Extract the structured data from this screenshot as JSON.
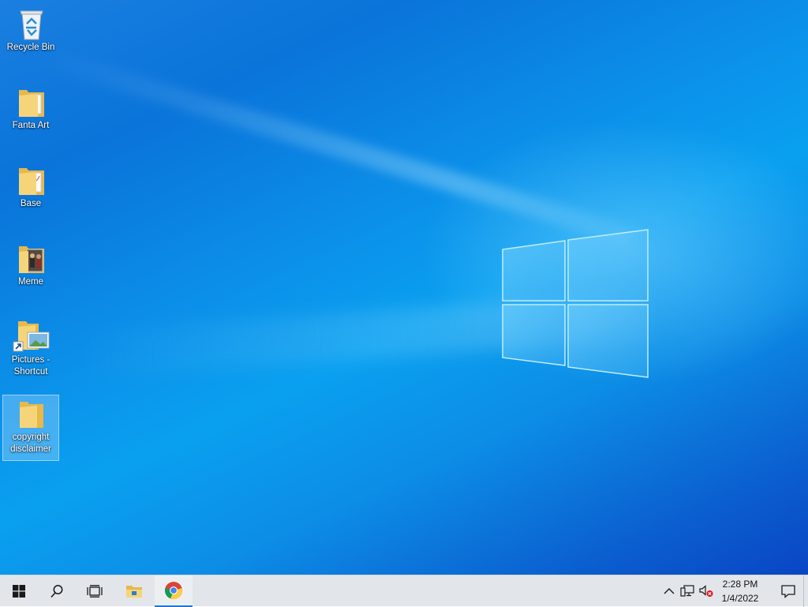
{
  "desktop": {
    "icons": [
      {
        "label": "Recycle Bin",
        "icon": "recycle-bin-icon",
        "selected": false
      },
      {
        "label": "Fanta Art",
        "icon": "folder-icon",
        "selected": false
      },
      {
        "label": "Base",
        "icon": "folder-icon",
        "selected": false
      },
      {
        "label": "Meme",
        "icon": "folder-icon",
        "selected": false
      },
      {
        "label": "Pictures - Shortcut",
        "icon": "folder-shortcut-icon",
        "selected": false
      },
      {
        "label": "copyright disclaimer",
        "icon": "folder-icon",
        "selected": true
      }
    ]
  },
  "taskbar": {
    "buttons": [
      {
        "name": "start",
        "icon": "windows-logo-icon"
      },
      {
        "name": "search",
        "icon": "search-icon"
      },
      {
        "name": "task-view",
        "icon": "task-view-icon"
      },
      {
        "name": "file-explorer",
        "icon": "file-explorer-icon"
      },
      {
        "name": "chrome",
        "icon": "chrome-icon",
        "active": true
      }
    ],
    "tray": {
      "time": "2:28 PM",
      "date": "1/4/2022"
    }
  },
  "colors": {
    "taskbar_bg": "#e2e6ea",
    "accent": "#1f78d1"
  }
}
